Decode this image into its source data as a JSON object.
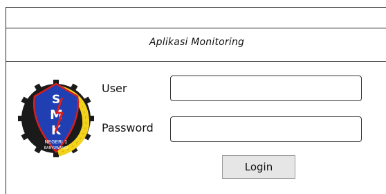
{
  "app": {
    "title": "Aplikasi Monitoring"
  },
  "form": {
    "user_label": "User",
    "password_label": "Password",
    "login_label": "Login"
  },
  "logo": {
    "letters": [
      "S",
      "M",
      "K"
    ],
    "banner": "NEGERI 1",
    "city": "BANYUWANGI",
    "colors": {
      "shield": "#1f3fb3",
      "gear": "#1a1a1a",
      "wreath": "#f2d21b",
      "letters": "#ffffff",
      "accent": "#d61f1f"
    }
  }
}
